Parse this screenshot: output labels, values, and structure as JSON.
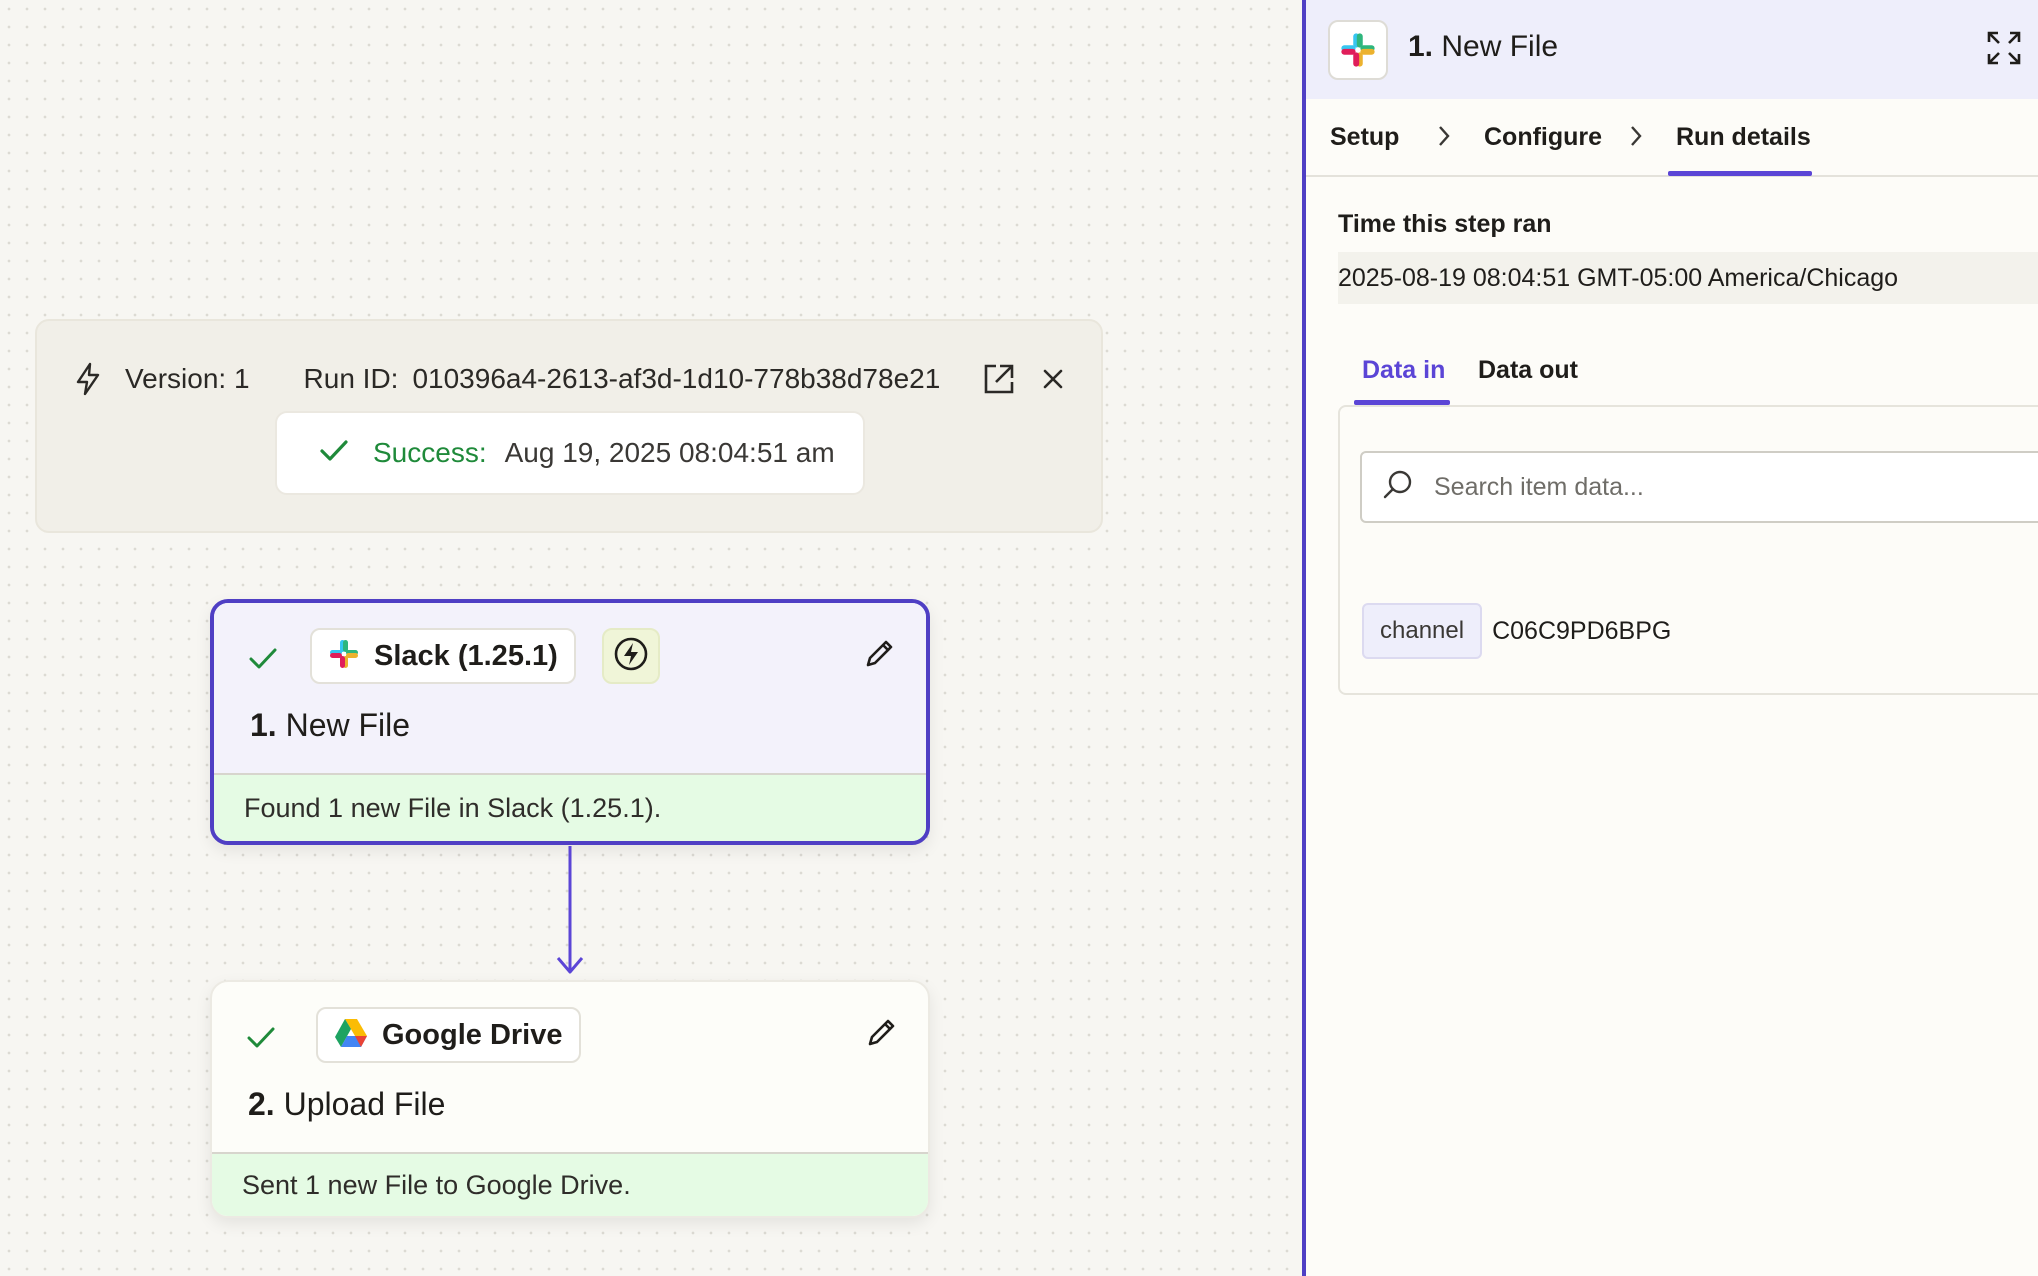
{
  "run_banner": {
    "version_label": "Version: 1",
    "run_id_label": "Run ID:",
    "run_id_value": "010396a4-2613-af3d-1d10-778b38d78e21",
    "status_word": "Success",
    "status_colon": ":",
    "status_date": "Aug 19, 2025 08:04:51 am",
    "status_color": "#1f8a3a"
  },
  "steps": [
    {
      "app_label": "Slack (1.25.1)",
      "app_icon": "slack-icon",
      "number": "1.",
      "title": "New File",
      "status": "Found 1 new File in Slack (1.25.1).",
      "trigger_icon": "lightning-circle-icon"
    },
    {
      "app_label": "Google Drive",
      "app_icon": "google-drive-icon",
      "number": "2.",
      "title": "Upload File",
      "status": "Sent 1 new File to Google Drive."
    }
  ],
  "panel": {
    "number": "1.",
    "title": "New File",
    "breadcrumbs": [
      "Setup",
      "Configure",
      "Run details"
    ],
    "active_crumb": "Run details",
    "time_label": "Time this step ran",
    "time_value": "2025-08-19 08:04:51 GMT-05:00 America/Chicago",
    "data_tabs": [
      "Data in",
      "Data out"
    ],
    "active_data_tab": "Data in",
    "search_placeholder": "Search item data...",
    "items": [
      {
        "key": "channel",
        "value": "C06C9PD6BPG"
      }
    ]
  },
  "colors": {
    "accent": "#5b45d6",
    "selected_border": "#4f3fc4",
    "success_bg": "#e5fbe4"
  }
}
